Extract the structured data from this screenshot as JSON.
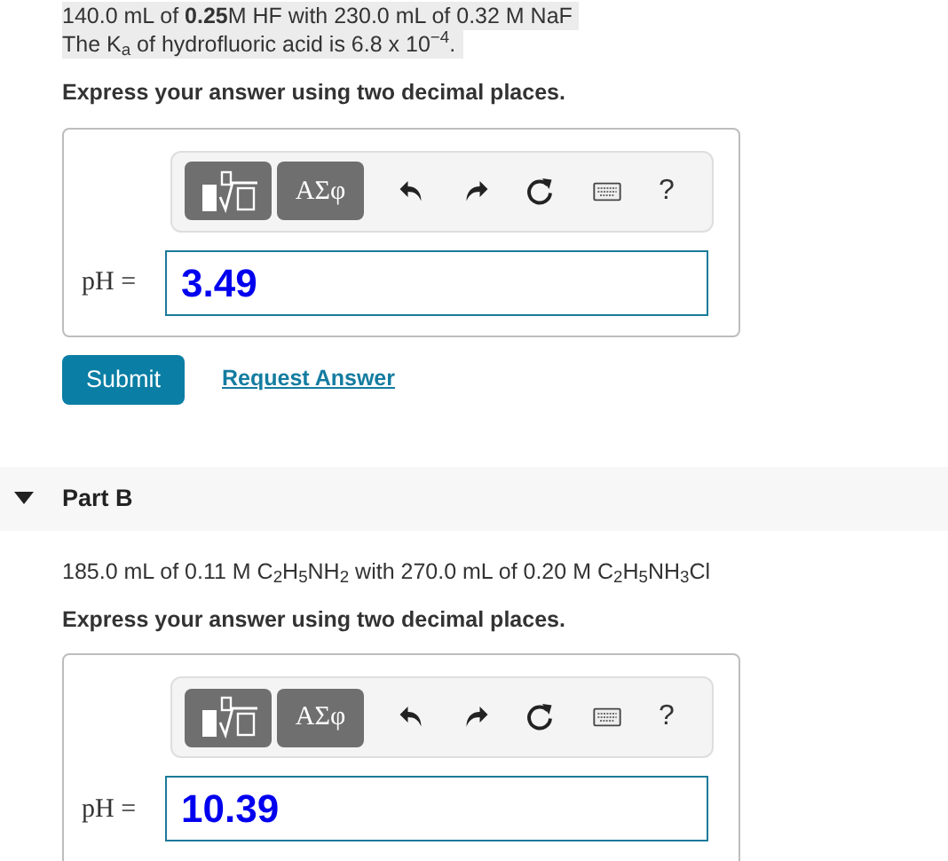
{
  "part_a": {
    "problem_lines": [
      "140.0 mL of **0.25**M HF with 230.0 mL of 0.32 M NaF",
      "The K$_{a}$ of hydrofluoric acid is 6.8 x 10$^{−4}$."
    ],
    "instruction": "Express your answer using two decimal places.",
    "toolbar": {
      "symbols_button": "ΑΣφ",
      "help_button": "?"
    },
    "answer": {
      "label": "pH =",
      "value": "3.49"
    },
    "submit": "Submit",
    "request_answer": "Request Answer"
  },
  "part_b": {
    "title": "Part B",
    "expanded": true,
    "problem": "185.0 mL of 0.11 M C$_{2}$H$_{5}$NH$_{2}$ with 270.0 mL of 0.20 M C$_{2}$H$_{5}$NH$_{3}$Cl",
    "instruction": "Express your answer using two decimal places.",
    "toolbar": {
      "symbols_button": "ΑΣφ",
      "help_button": "?"
    },
    "answer": {
      "label": "pH =",
      "value": "10.39"
    }
  }
}
